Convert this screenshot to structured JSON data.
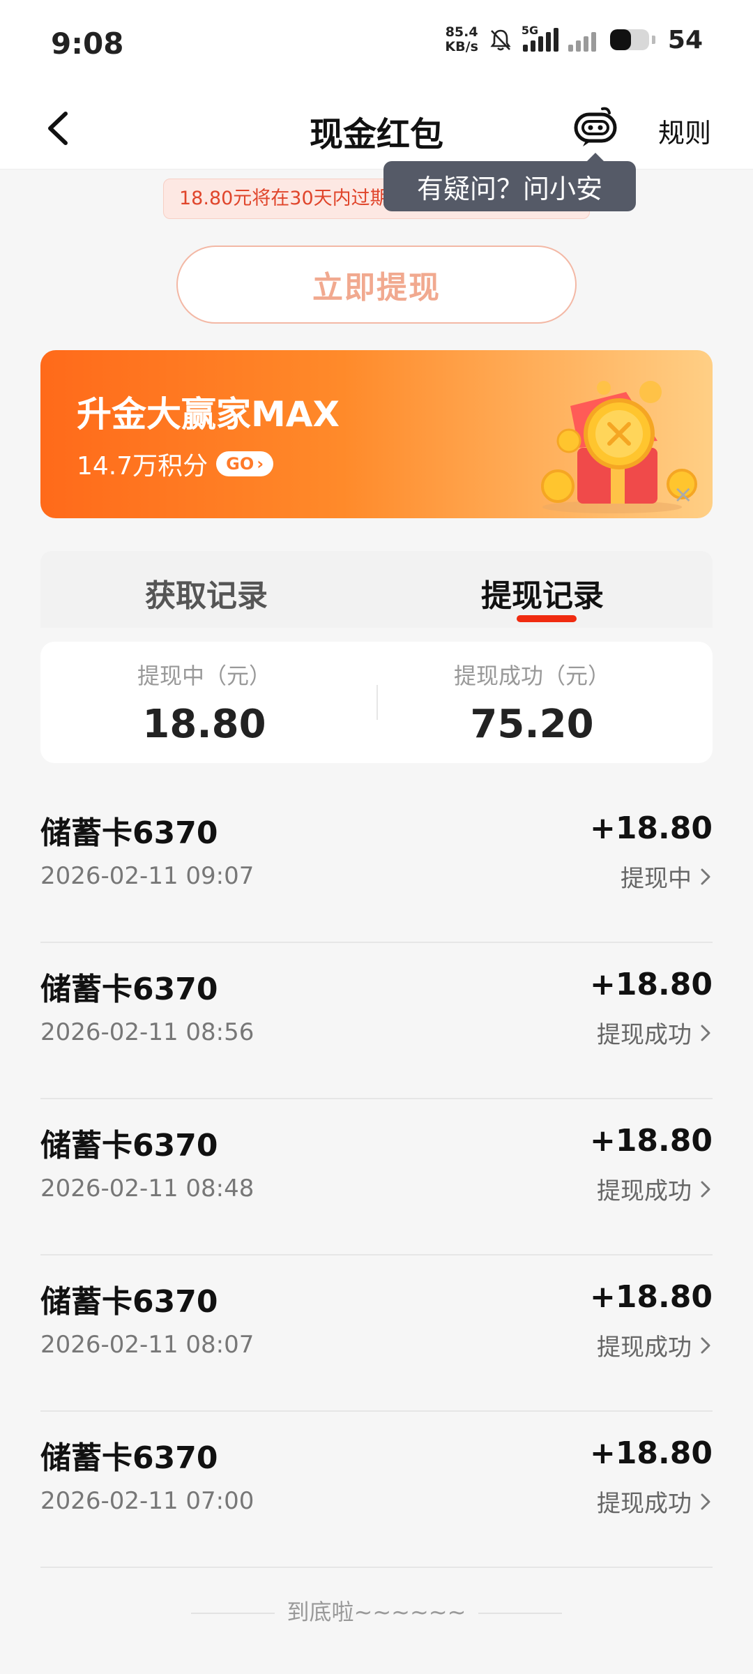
{
  "status_bar": {
    "time": "9:08",
    "net_speed_value": "85.4",
    "net_speed_unit": "KB/s",
    "net_type": "5G",
    "battery_level": 0.54,
    "battery_percent": "54"
  },
  "header": {
    "title": "现金红包",
    "rules_label": "规则",
    "tooltip": "有疑问？问小安"
  },
  "notice": {
    "text": "18.80元将在30天内过期，如已提现请忽略。"
  },
  "withdraw_button": "立即提现",
  "banner": {
    "title": "升金大赢家MAX",
    "subtitle": "14.7万积分",
    "go_label": "GO",
    "close_label": "×"
  },
  "tabs": [
    {
      "label": "获取记录",
      "active": false
    },
    {
      "label": "提现记录",
      "active": true
    }
  ],
  "summary": {
    "pending_label": "提现中（元）",
    "pending_value": "18.80",
    "success_label": "提现成功（元）",
    "success_value": "75.20"
  },
  "records": [
    {
      "name": "储蓄卡6370",
      "time": "2026-02-11 09:07",
      "amount": "+18.80",
      "status": "提现中"
    },
    {
      "name": "储蓄卡6370",
      "time": "2026-02-11 08:56",
      "amount": "+18.80",
      "status": "提现成功"
    },
    {
      "name": "储蓄卡6370",
      "time": "2026-02-11 08:48",
      "amount": "+18.80",
      "status": "提现成功"
    },
    {
      "name": "储蓄卡6370",
      "time": "2026-02-11 08:07",
      "amount": "+18.80",
      "status": "提现成功"
    },
    {
      "name": "储蓄卡6370",
      "time": "2026-02-11 07:00",
      "amount": "+18.80",
      "status": "提现成功"
    }
  ],
  "footer": "到底啦~~~~~~",
  "colors": {
    "accent": "#f02b10",
    "banner_start": "#ff6a1a",
    "banner_end": "#ffcf85",
    "tooltip_bg": "#555a67"
  }
}
